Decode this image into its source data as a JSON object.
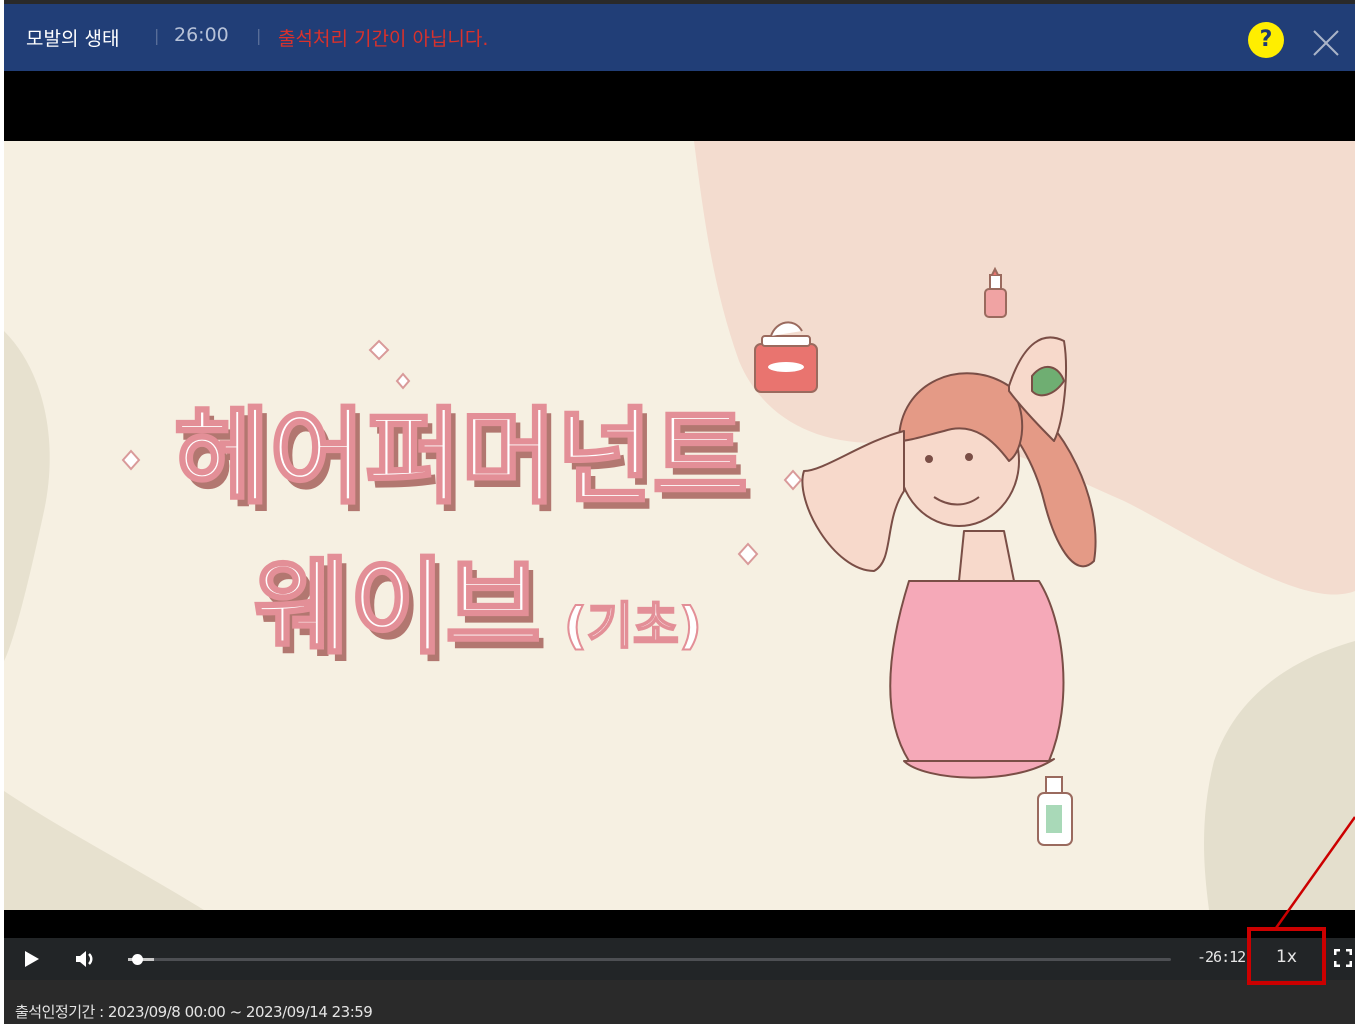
{
  "header": {
    "title": "모발의 생태",
    "separator": "|",
    "duration": "26:00",
    "attendance_warning": "출석처리 기간이 아닙니다.",
    "help_label": "?",
    "icons": {
      "help": "help-icon",
      "close": "close-icon"
    },
    "colors": {
      "bar": "#213e77",
      "warning": "#d9312c",
      "help": "#ffee00"
    }
  },
  "video": {
    "slide_title_line1": "헤어퍼머넌트",
    "slide_title_line2": "웨이브",
    "slide_title_suffix": "(기초)"
  },
  "player": {
    "progress_fraction": 0.004,
    "remaining_time": "-26:12",
    "speed_label": "1x",
    "icons": {
      "play": "play-icon",
      "volume": "volume-icon",
      "fullscreen": "fullscreen-icon"
    }
  },
  "footer": {
    "attendance_period": "출석인정기간 : 2023/09/8 00:00 ~ 2023/09/14 23:59"
  },
  "annotation": {
    "color": "#cc0000"
  }
}
